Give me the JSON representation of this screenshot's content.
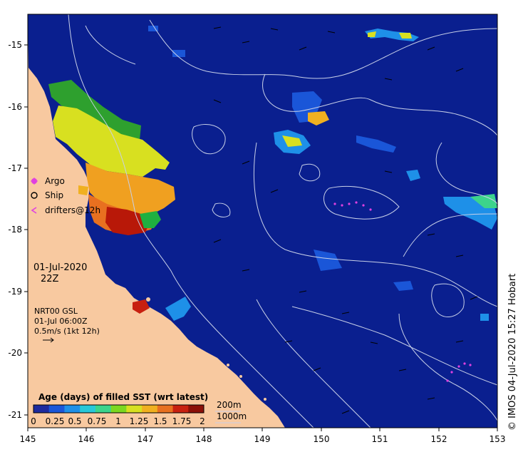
{
  "map": {
    "date": "01-Jul-2020",
    "time": "22Z",
    "legend_markers": [
      {
        "label": "Argo",
        "color": "#e040e0"
      },
      {
        "label": "Ship",
        "color": "#000000"
      },
      {
        "label": "drifters@12h",
        "color": "#e040e0"
      }
    ],
    "current_info": {
      "line1": "NRT00 GSL",
      "line2": "01-Jul 06:00Z",
      "line3": "0.5m/s (1kt 12h)"
    },
    "colorbar": {
      "title": "Age (days) of filled SST (wrt latest)",
      "ticks": [
        "0",
        "0.25",
        "0.5",
        "0.75",
        "1",
        "1.25",
        "1.5",
        "1.75",
        "2"
      ],
      "colors": [
        "#1d2a9e",
        "#1a56d8",
        "#1e90e8",
        "#28c8d8",
        "#3cd48c",
        "#7cd820",
        "#d8e020",
        "#f0b020",
        "#e87020",
        "#c82010",
        "#8c1008"
      ]
    },
    "contours": {
      "line1": "200m",
      "line2": "1000m"
    },
    "longitudes": [
      "145",
      "146",
      "147",
      "148",
      "149",
      "150",
      "151",
      "152",
      "153"
    ],
    "latitudes": [
      "-15",
      "-16",
      "-17",
      "-18",
      "-19",
      "-20",
      "-21"
    ],
    "credit": "© IMOS 04-Jul-2020 15:27 Hobart",
    "colors": {
      "ocean": "#0a1f8f",
      "land": "#f8c9a0",
      "contour": "#c8d0e8"
    }
  }
}
